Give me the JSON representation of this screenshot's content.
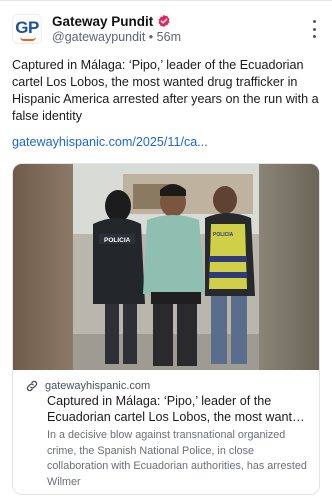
{
  "post": {
    "author": {
      "avatar_text": "GP",
      "display_name": "Gateway Pundit",
      "handle": "@gatewaypundit",
      "separator": "•",
      "time": "56m",
      "verified": true
    },
    "text": "Captured in Málaga: ‘Pipo,’ leader of the Ecuadorian cartel Los Lobos, the most wanted drug trafficker in Hispanic America arrested after years on the run with a false identity",
    "link_text": "gatewayhispanic.com/2025/11/ca..."
  },
  "link_card": {
    "domain": "gatewayhispanic.com",
    "title": "Captured in Málaga: ‘Pipo,’ leader of the Ecuadorian cartel Los Lobos, the most wanted drug trafficker in Hispanic America",
    "description": "In a decisive blow against transnational organized crime, the Spanish National Police, in close collaboration with Ecuadorian authorities, has arrested Wilmer",
    "image_patch_text": "POLICIA",
    "image_vest_text": "POLICIA"
  },
  "colors": {
    "link": "#1a67d2",
    "verified_badge": "#e0245e",
    "brand_blue": "#1b4f9c",
    "brand_orange": "#e46a1a"
  },
  "icons": {
    "verified": "verified-badge-icon",
    "more": "more-vertical-icon",
    "link": "link-icon"
  }
}
